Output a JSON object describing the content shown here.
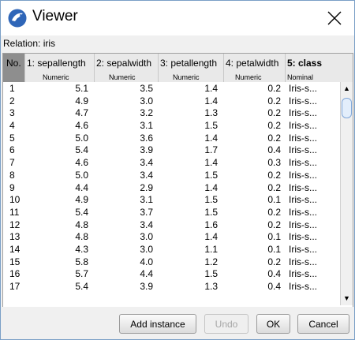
{
  "window": {
    "title": "Viewer"
  },
  "relation_label": "Relation: iris",
  "table": {
    "columns": [
      {
        "name": "No.",
        "type": ""
      },
      {
        "name": "1: sepallength",
        "type": "Numeric"
      },
      {
        "name": "2: sepalwidth",
        "type": "Numeric"
      },
      {
        "name": "3: petallength",
        "type": "Numeric"
      },
      {
        "name": "4: petalwidth",
        "type": "Numeric"
      },
      {
        "name": "5: class",
        "type": "Nominal"
      }
    ],
    "rows": [
      [
        "1",
        "5.1",
        "3.5",
        "1.4",
        "0.2",
        "Iris-s..."
      ],
      [
        "2",
        "4.9",
        "3.0",
        "1.4",
        "0.2",
        "Iris-s..."
      ],
      [
        "3",
        "4.7",
        "3.2",
        "1.3",
        "0.2",
        "Iris-s..."
      ],
      [
        "4",
        "4.6",
        "3.1",
        "1.5",
        "0.2",
        "Iris-s..."
      ],
      [
        "5",
        "5.0",
        "3.6",
        "1.4",
        "0.2",
        "Iris-s..."
      ],
      [
        "6",
        "5.4",
        "3.9",
        "1.7",
        "0.4",
        "Iris-s..."
      ],
      [
        "7",
        "4.6",
        "3.4",
        "1.4",
        "0.3",
        "Iris-s..."
      ],
      [
        "8",
        "5.0",
        "3.4",
        "1.5",
        "0.2",
        "Iris-s..."
      ],
      [
        "9",
        "4.4",
        "2.9",
        "1.4",
        "0.2",
        "Iris-s..."
      ],
      [
        "10",
        "4.9",
        "3.1",
        "1.5",
        "0.1",
        "Iris-s..."
      ],
      [
        "11",
        "5.4",
        "3.7",
        "1.5",
        "0.2",
        "Iris-s..."
      ],
      [
        "12",
        "4.8",
        "3.4",
        "1.6",
        "0.2",
        "Iris-s..."
      ],
      [
        "13",
        "4.8",
        "3.0",
        "1.4",
        "0.1",
        "Iris-s..."
      ],
      [
        "14",
        "4.3",
        "3.0",
        "1.1",
        "0.1",
        "Iris-s..."
      ],
      [
        "15",
        "5.8",
        "4.0",
        "1.2",
        "0.2",
        "Iris-s..."
      ],
      [
        "16",
        "5.7",
        "4.4",
        "1.5",
        "0.4",
        "Iris-s..."
      ],
      [
        "17",
        "5.4",
        "3.9",
        "1.3",
        "0.4",
        "Iris-s..."
      ]
    ]
  },
  "buttons": {
    "add_instance": "Add instance",
    "undo": "Undo",
    "ok": "OK",
    "cancel": "Cancel"
  },
  "icons": {
    "app": "weka-bird-icon",
    "close": "close-icon"
  },
  "colors": {
    "app_icon_bg": "#2f66b8",
    "header_bg": "#e9e9e9",
    "selected_header_bg": "#8e8e8e",
    "scroll_thumb_border": "#7fa6d9"
  }
}
